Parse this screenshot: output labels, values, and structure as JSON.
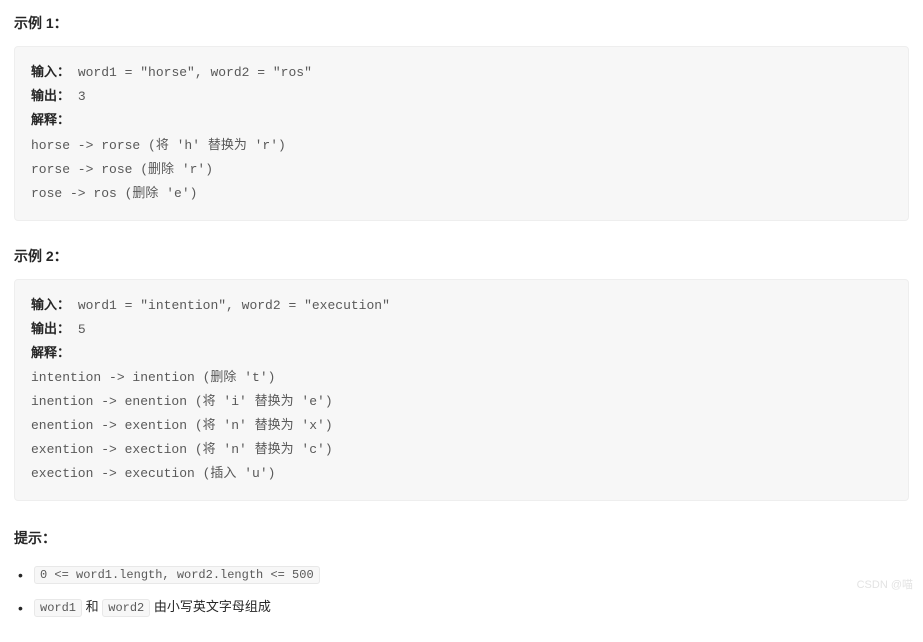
{
  "example1": {
    "heading": "示例 1：",
    "input_label": "输入：",
    "input_value": "word1 = \"horse\", word2 = \"ros\"",
    "output_label": "输出：",
    "output_value": "3",
    "explain_label": "解释：",
    "lines": [
      "horse -> rorse (将 'h' 替换为 'r')",
      "rorse -> rose (删除 'r')",
      "rose -> ros (删除 'e')"
    ]
  },
  "example2": {
    "heading": "示例 2：",
    "input_label": "输入：",
    "input_value": "word1 = \"intention\", word2 = \"execution\"",
    "output_label": "输出：",
    "output_value": "5",
    "explain_label": "解释：",
    "lines": [
      "intention -> inention (删除 't')",
      "inention -> enention (将 'i' 替换为 'e')",
      "enention -> exention (将 'n' 替换为 'x')",
      "exention -> exection (将 'n' 替换为 'c')",
      "exection -> execution (插入 'u')"
    ]
  },
  "hints": {
    "heading": "提示：",
    "items": [
      {
        "type": "code",
        "text": "0 <= word1.length, word2.length <= 500"
      },
      {
        "type": "mixed",
        "parts": [
          {
            "kind": "code",
            "text": "word1"
          },
          {
            "kind": "text",
            "text": " 和 "
          },
          {
            "kind": "code",
            "text": "word2"
          },
          {
            "kind": "text",
            "text": " 由小写英文字母组成"
          }
        ]
      }
    ]
  },
  "watermark": "CSDN @喵"
}
